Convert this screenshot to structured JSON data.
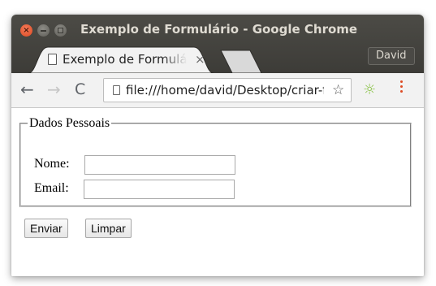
{
  "window": {
    "title": "Exemplo de Formulário - Google Chrome",
    "controls": [
      "close",
      "minimize",
      "maximize"
    ]
  },
  "tab": {
    "title": "Exemplo de Formulário",
    "close_glyph": "×",
    "icon": "page-icon"
  },
  "profile": {
    "name": "David"
  },
  "toolbar": {
    "back_glyph": "←",
    "forward_glyph": "→",
    "reload_glyph": "C",
    "url": "file:///home/david/Desktop/criar-formulario.html",
    "star_glyph": "☆",
    "extension_icon": "sun-icon",
    "menu_icon": "vertical-dots-icon",
    "accent_color": "#dd4a23"
  },
  "form": {
    "legend": "Dados Pessoais",
    "fields": [
      {
        "label": "Nome:",
        "value": ""
      },
      {
        "label": "Email:",
        "value": ""
      }
    ],
    "buttons": {
      "submit": "Enviar",
      "reset": "Limpar"
    }
  }
}
